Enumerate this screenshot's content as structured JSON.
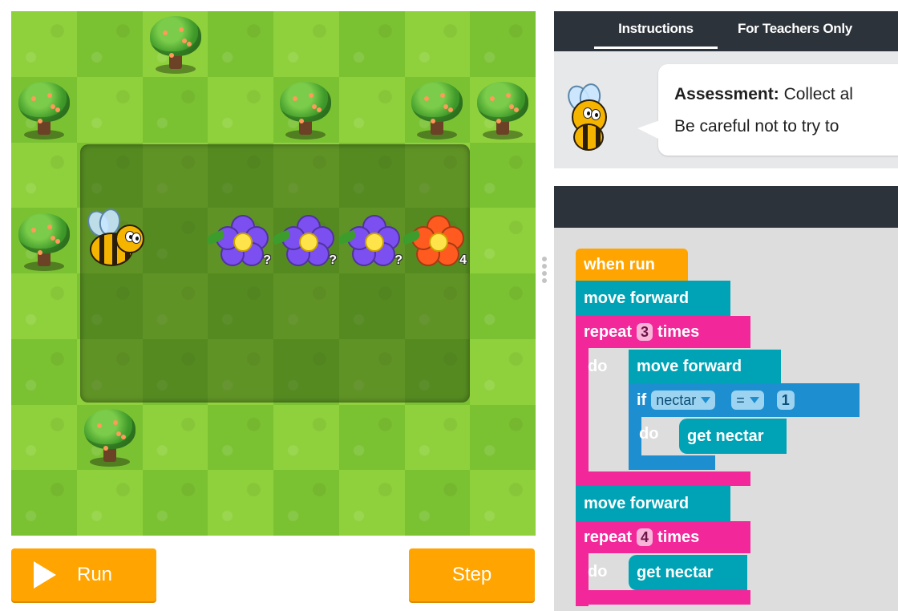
{
  "controls": {
    "run_label": "Run",
    "step_label": "Step"
  },
  "tabs": {
    "instructions": "Instructions",
    "teachers": "For Teachers Only"
  },
  "instructions": {
    "heading": "Assessment:",
    "line1_rest": " Collect al",
    "line2": "Be careful not to try to"
  },
  "board": {
    "flowers": [
      {
        "color": "purple",
        "count": "?"
      },
      {
        "color": "purple",
        "count": "?"
      },
      {
        "color": "purple",
        "count": "?"
      },
      {
        "color": "red",
        "count": "4"
      }
    ]
  },
  "blocks": {
    "when_run": "when run",
    "move_forward_1": "move forward",
    "repeat_1": "repeat",
    "repeat_1_count": "3",
    "repeat_1_times": "times",
    "do_1": "do",
    "move_forward_2": "move forward",
    "if_label": "if",
    "if_variable": "nectar",
    "if_operator": "=",
    "if_value": "1",
    "do_if": "do",
    "get_nectar_1": "get nectar",
    "move_forward_3": "move forward",
    "repeat_2": "repeat",
    "repeat_2_count": "4",
    "repeat_2_times": "times",
    "do_2": "do",
    "get_nectar_2": "get nectar"
  },
  "colors": {
    "run_button": "#ffa400",
    "event_block": "#ffa400",
    "action_block": "#00a3b5",
    "loop_block": "#f2289a",
    "logic_block": "#1d8ecf",
    "tab_bar": "#2d333b"
  }
}
